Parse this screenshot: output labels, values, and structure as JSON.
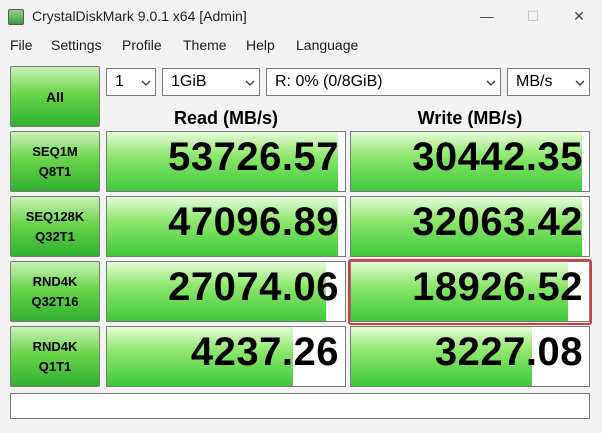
{
  "window": {
    "title": "CrystalDiskMark 9.0.1 x64 [Admin]",
    "minimize": "—",
    "maximize": "☐",
    "close": "✕"
  },
  "menu": [
    "File",
    "Settings",
    "Profile",
    "Theme",
    "Help",
    "Language"
  ],
  "controls": {
    "all_label": "All",
    "count": "1",
    "size": "1GiB",
    "drive": "R: 0% (0/8GiB)",
    "unit": "MB/s"
  },
  "headers": {
    "read": "Read (MB/s)",
    "write": "Write (MB/s)"
  },
  "tests": [
    {
      "label": "SEQ1M\nQ8T1",
      "read": "53726.57",
      "write": "30442.35",
      "read_fill": 0.97,
      "write_fill": 0.97
    },
    {
      "label": "SEQ128K\nQ32T1",
      "read": "47096.89",
      "write": "32063.42",
      "read_fill": 0.97,
      "write_fill": 0.97
    },
    {
      "label": "RND4K\nQ32T16",
      "read": "27074.06",
      "write": "18926.52",
      "read_fill": 0.92,
      "write_fill": 0.91
    },
    {
      "label": "RND4K\nQ1T1",
      "read": "4237.26",
      "write": "3227.08",
      "read_fill": 0.78,
      "write_fill": 0.76
    }
  ],
  "status": ""
}
